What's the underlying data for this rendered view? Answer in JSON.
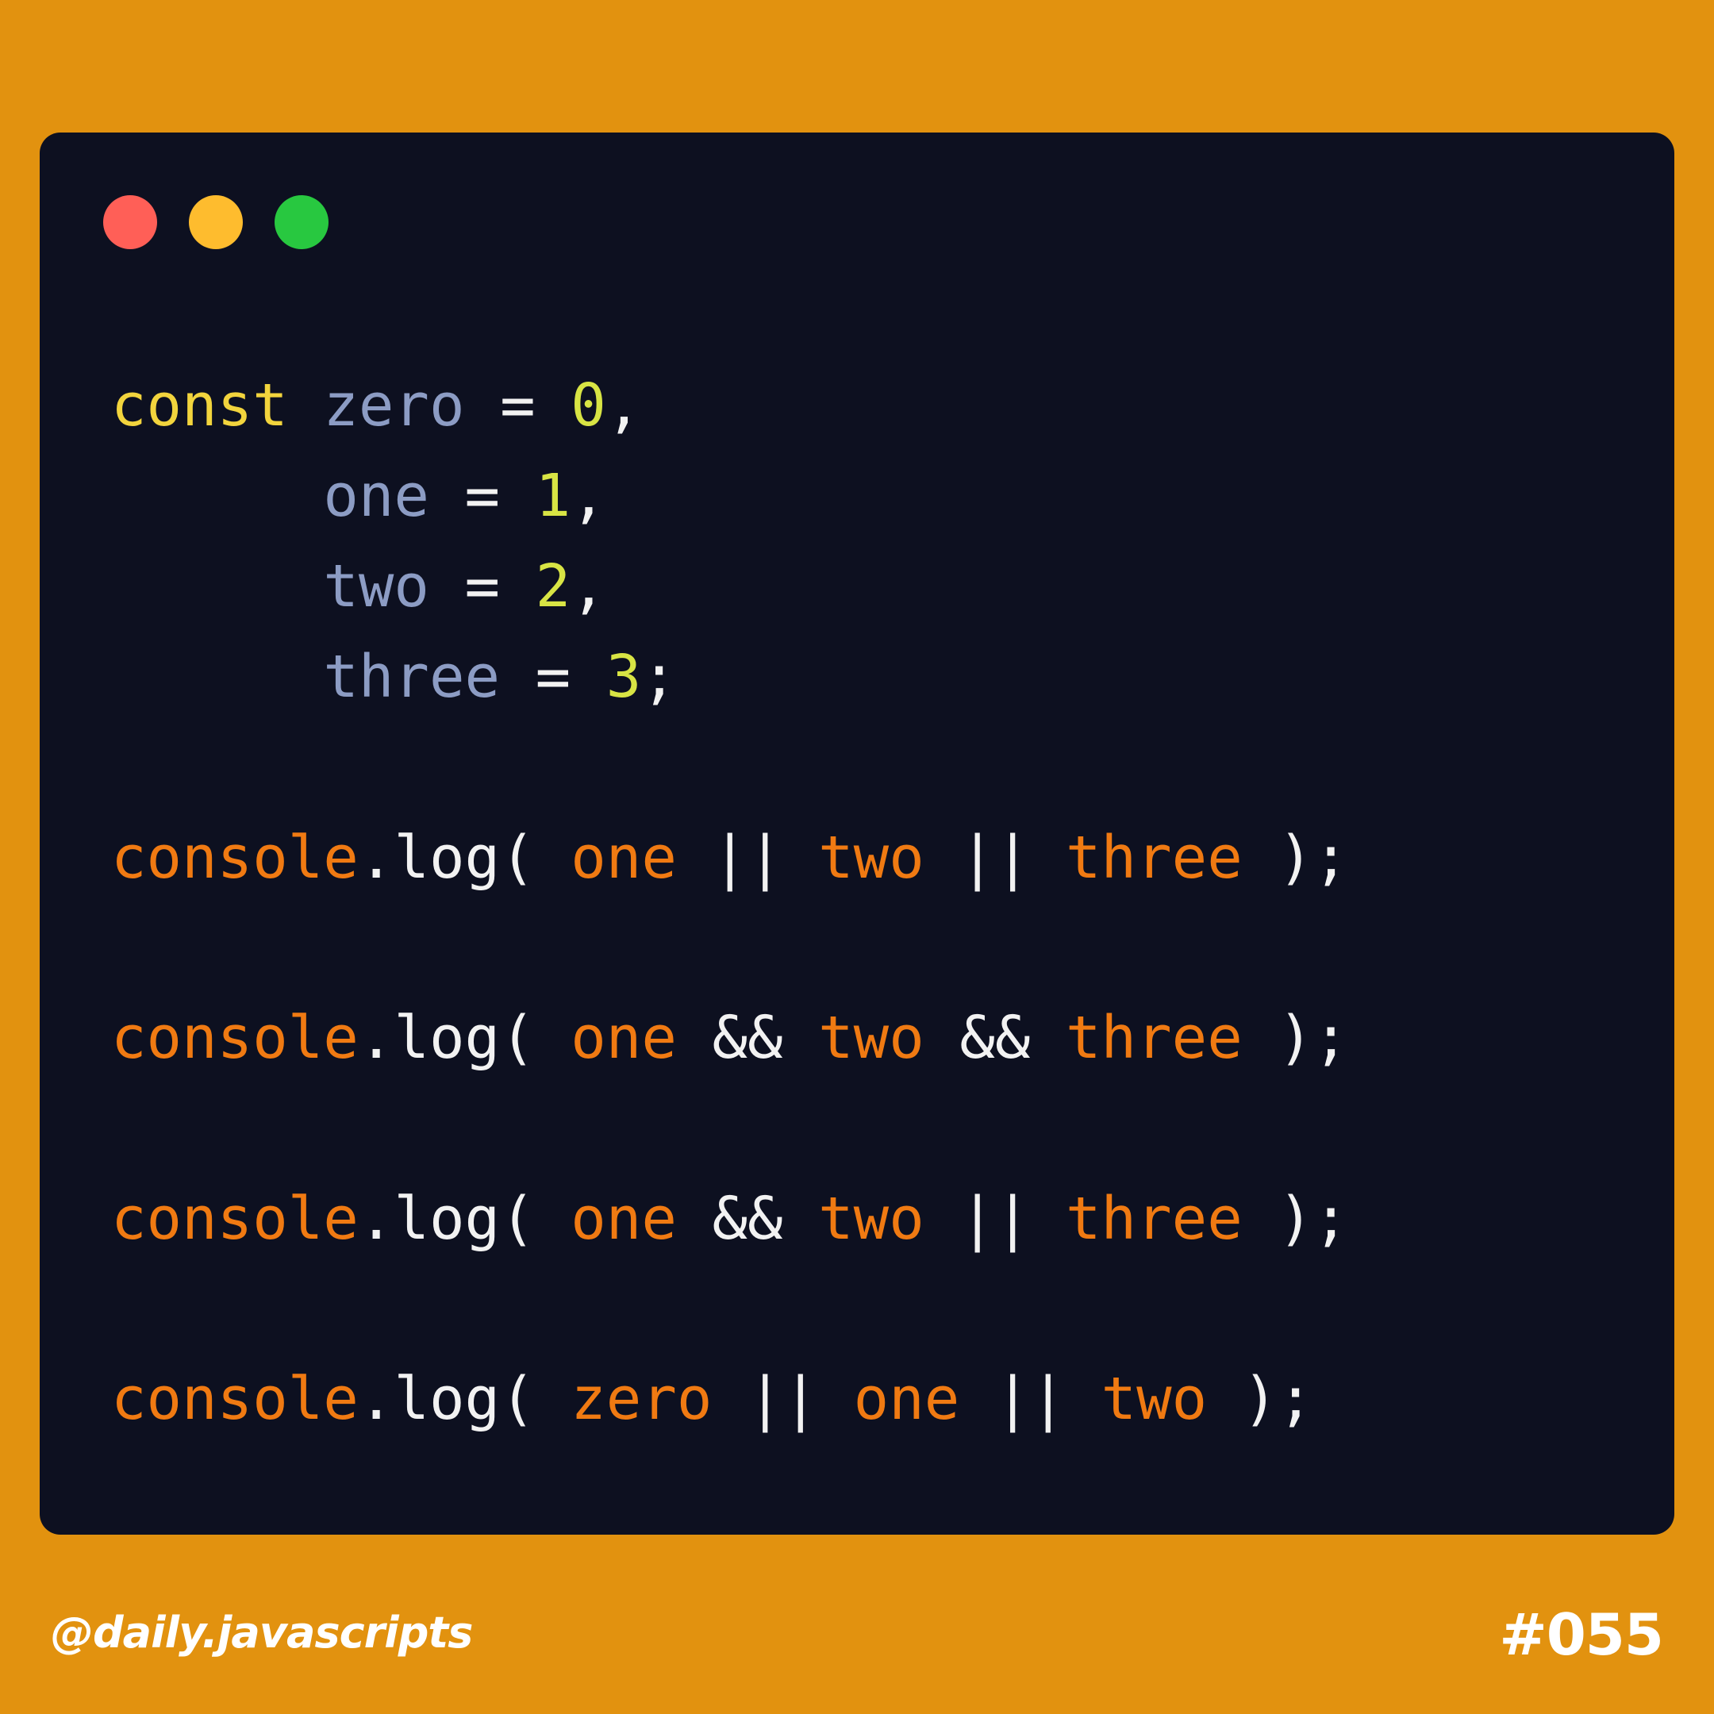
{
  "window": {
    "controls": {
      "close_color": "#FF5F57",
      "minimize_color": "#FEBC2E",
      "maximize_color": "#28C840"
    }
  },
  "code": {
    "line1": {
      "keyword": "const",
      "name": "zero",
      "op": "=",
      "value": "0",
      "end": ","
    },
    "line2": {
      "name": "one",
      "op": "=",
      "value": "1",
      "end": ","
    },
    "line3": {
      "name": "two",
      "op": "=",
      "value": "2",
      "end": ","
    },
    "line4": {
      "name": "three",
      "op": "=",
      "value": "3",
      "end": ";"
    },
    "log1": {
      "obj": "console",
      "dot": ".",
      "fn": "log(",
      "a": "one",
      "op1": "||",
      "b": "two",
      "op2": "||",
      "c": "three",
      "close": ");"
    },
    "log2": {
      "obj": "console",
      "dot": ".",
      "fn": "log(",
      "a": "one",
      "op1": "&&",
      "b": "two",
      "op2": "&&",
      "c": "three",
      "close": ");"
    },
    "log3": {
      "obj": "console",
      "dot": ".",
      "fn": "log(",
      "a": "one",
      "op1": "&&",
      "b": "two",
      "op2": "||",
      "c": "three",
      "close": ");"
    },
    "log4": {
      "obj": "console",
      "dot": ".",
      "fn": "log(",
      "a": "zero",
      "op1": "||",
      "b": "one",
      "op2": "||",
      "c": "two",
      "close": ");"
    }
  },
  "footer": {
    "handle": "@daily.javascripts",
    "number": "#055"
  },
  "colors": {
    "background": "#E2920F",
    "editor_background": "#0D1020",
    "keyword": "#F2D43D",
    "variable": "#8C9CC4",
    "number": "#D8E444",
    "reference": "#F07A12",
    "punctuation": "#F2F2F2"
  }
}
